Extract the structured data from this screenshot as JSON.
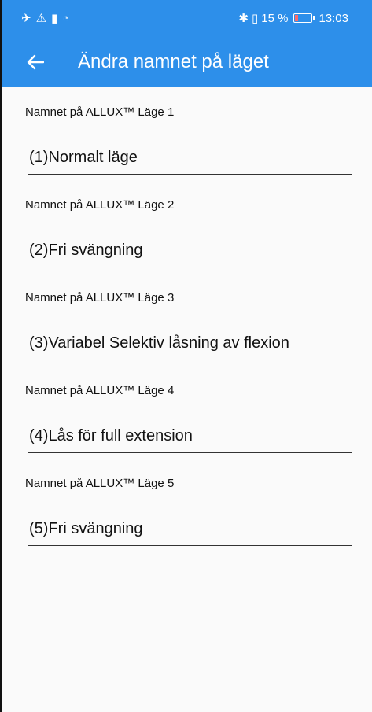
{
  "status_bar": {
    "left_icons": [
      "airplane-mode-icon",
      "warning-icon",
      "battery-saver-icon",
      "wifi-icon"
    ],
    "bluetooth_icon": "bluetooth-icon",
    "vibrate_icon": "vibrate-icon",
    "battery_text": "15 %",
    "battery_level": 0.15,
    "time": "13:03"
  },
  "app_bar": {
    "back_icon": "arrow-left-icon",
    "title": "Ändra namnet på läget",
    "color": "#2d8fea"
  },
  "fields": [
    {
      "label": "Namnet på ALLUX™ Läge 1",
      "value": "(1)Normalt läge"
    },
    {
      "label": "Namnet på ALLUX™ Läge 2",
      "value": "(2)Fri svängning"
    },
    {
      "label": "Namnet på ALLUX™ Läge 3",
      "value": "(3)Variabel Selektiv låsning av flexion"
    },
    {
      "label": "Namnet på ALLUX™ Läge 4",
      "value": "(4)Lås för full extension"
    },
    {
      "label": "Namnet på ALLUX™ Läge 5",
      "value": "(5)Fri svängning"
    }
  ]
}
